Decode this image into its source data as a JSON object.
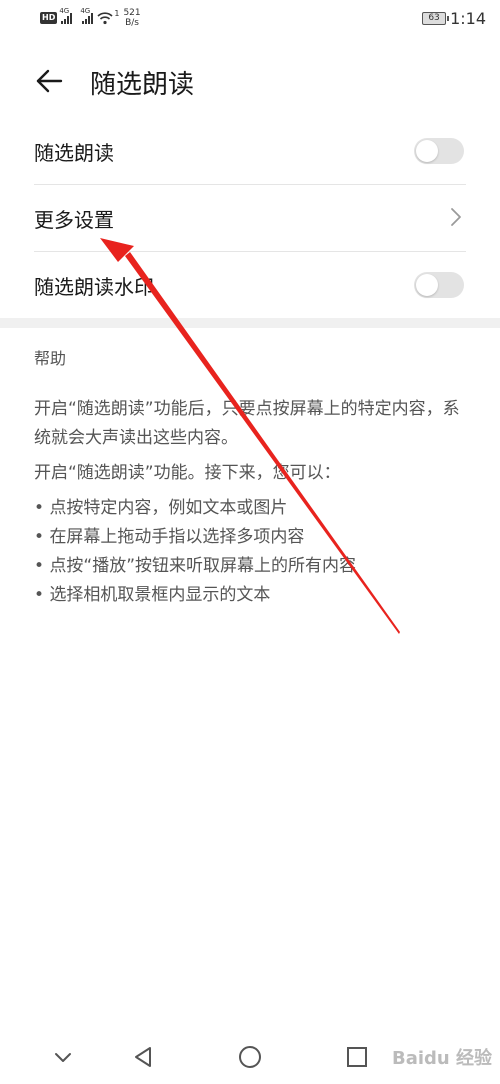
{
  "status_bar": {
    "hd_label": "HD",
    "sig1_label": "4G",
    "sig2_label": "4G",
    "wifi_badge": "1",
    "speed_value": "521",
    "speed_unit": "B/s",
    "battery": "63",
    "time": "1:14"
  },
  "header": {
    "title": "随选朗读"
  },
  "settings": {
    "items": [
      {
        "label": "随选朗读",
        "control": "toggle",
        "enabled": false
      },
      {
        "label": "更多设置",
        "control": "chevron"
      },
      {
        "label": "随选朗读水印",
        "control": "toggle",
        "enabled": false
      }
    ]
  },
  "help": {
    "title": "帮助",
    "paragraph1": "开启“随选朗读”功能后，只要点按屏幕上的特定内容，系统就会大声读出这些内容。",
    "paragraph2": "开启“随选朗读”功能。接下来，您可以：",
    "bullets": [
      "点按特定内容，例如文本或图片",
      "在屏幕上拖动手指以选择多项内容",
      "点按“播放”按钮来听取屏幕上的所有内容",
      "选择相机取景框内显示的文本"
    ]
  },
  "annotation": {
    "color": "#e8231e"
  },
  "watermark": {
    "text": "Baidu 经验"
  },
  "icons": {
    "back": "arrow-left-icon",
    "chevron": "chevron-right-icon",
    "nav_down": "chevron-down-icon",
    "nav_back": "triangle-back-icon",
    "nav_home": "circle-home-icon",
    "nav_recent": "square-recent-icon"
  }
}
